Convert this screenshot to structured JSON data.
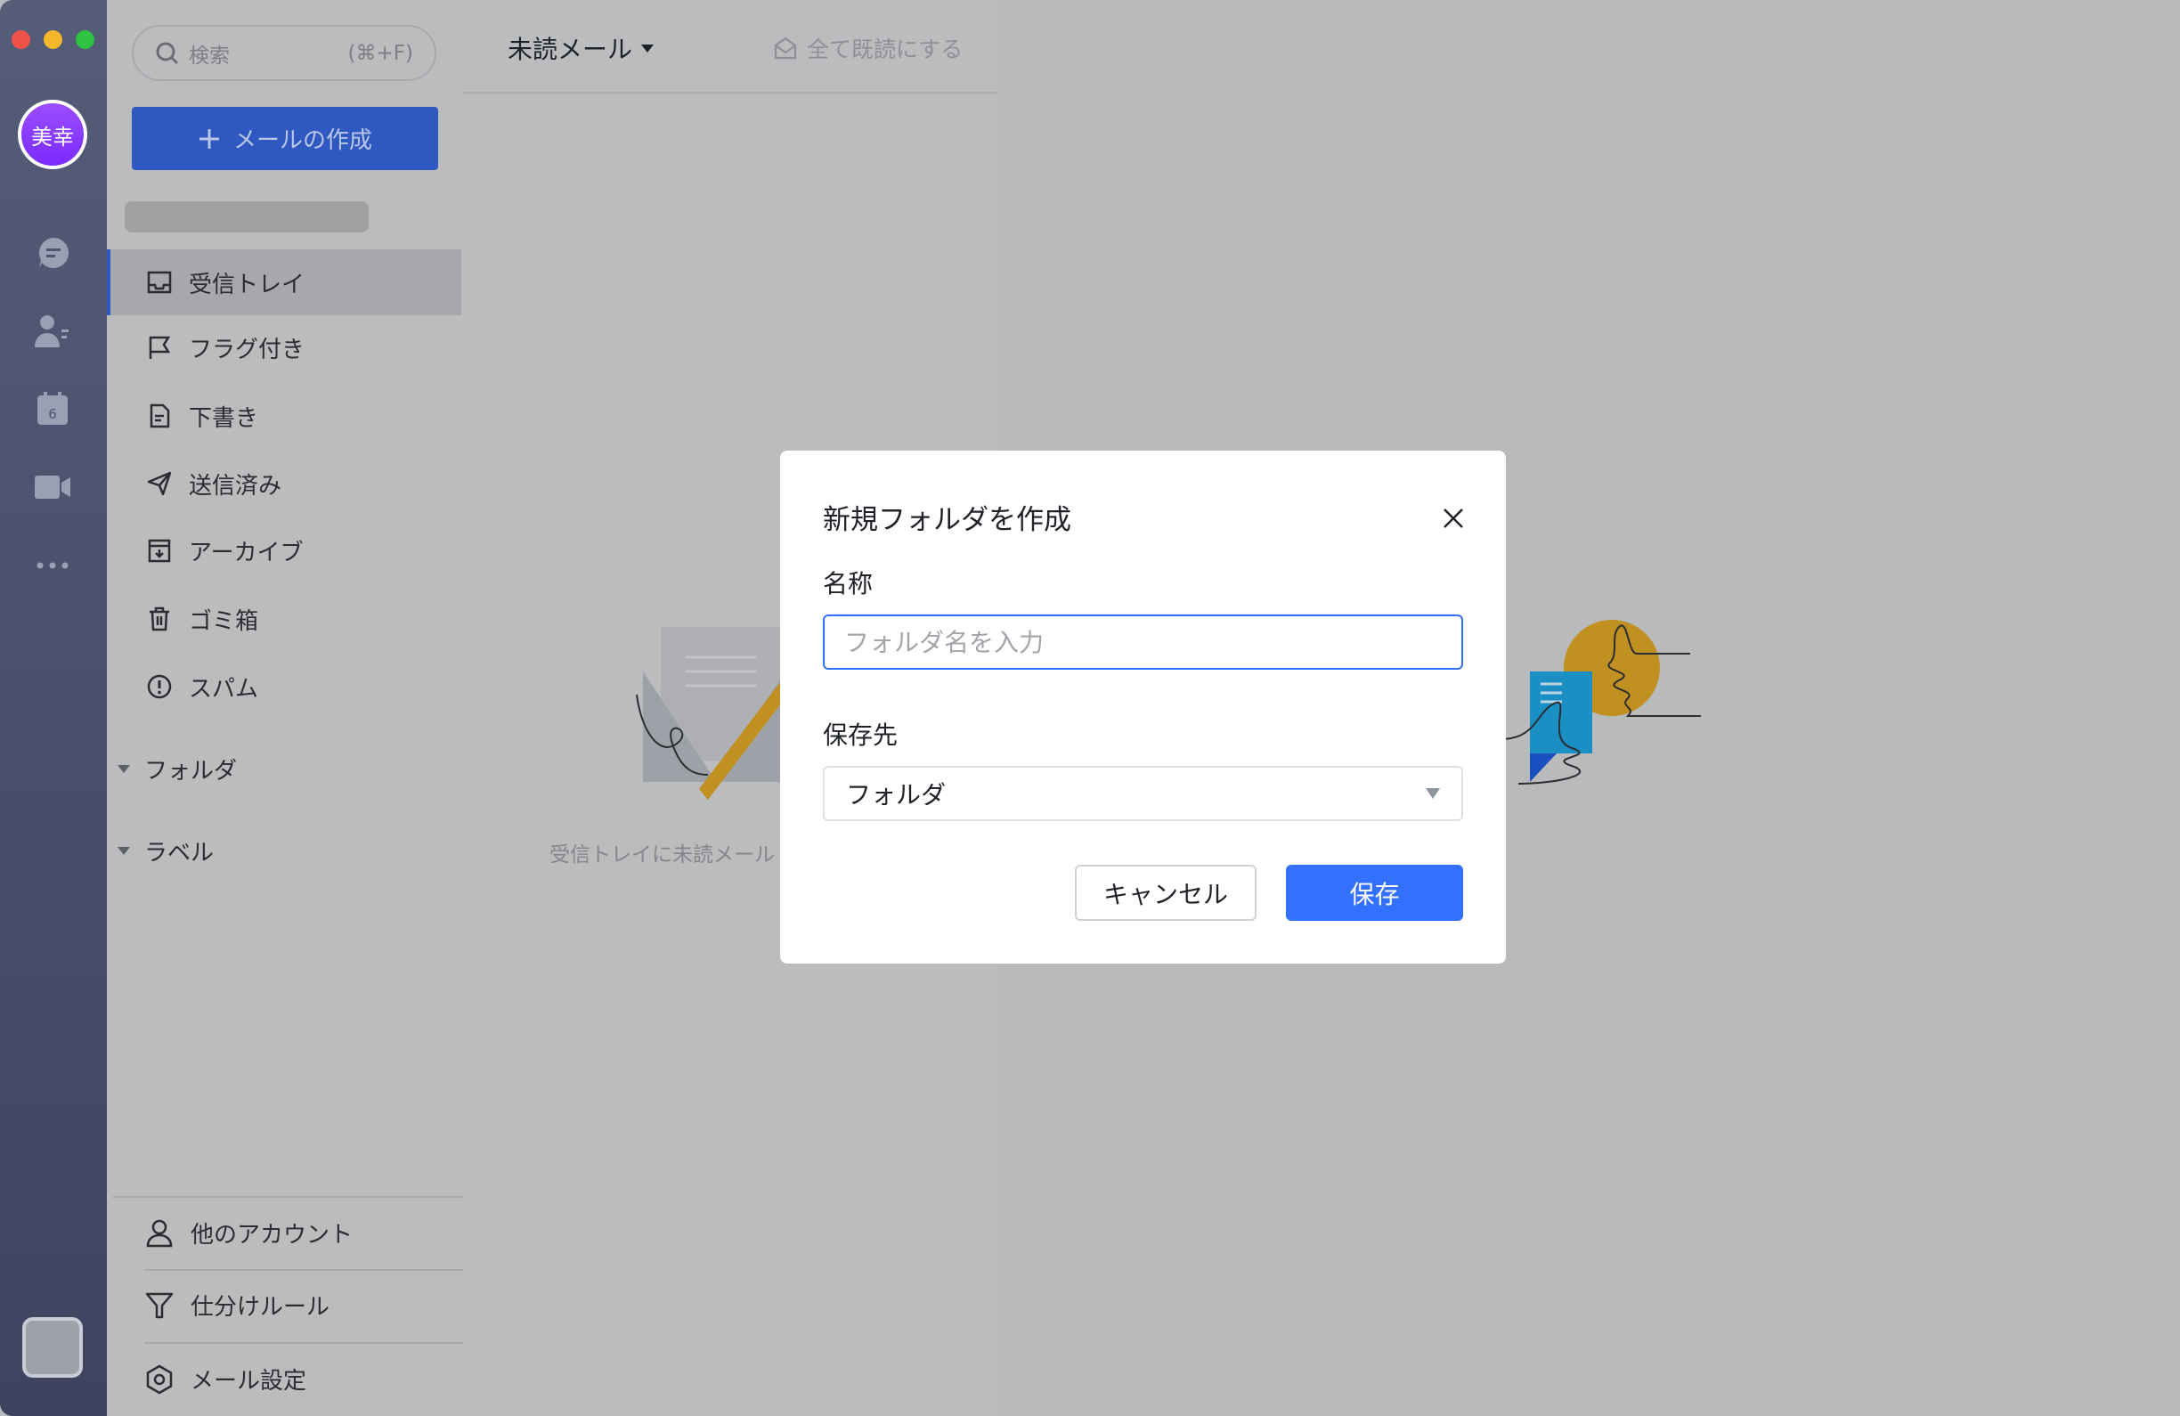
{
  "rail": {
    "avatar_text": "美幸",
    "icons": [
      "chat-icon",
      "contacts-icon",
      "calendar-icon",
      "video-icon",
      "more-icon"
    ],
    "calendar_day": "6"
  },
  "sidebar": {
    "search_placeholder": "検索",
    "search_shortcut": "(⌘+F)",
    "compose_label": "メールの作成",
    "items": [
      {
        "label": "受信トレイ",
        "icon": "inbox-icon",
        "selected": true
      },
      {
        "label": "フラグ付き",
        "icon": "flag-icon"
      },
      {
        "label": "下書き",
        "icon": "draft-icon"
      },
      {
        "label": "送信済み",
        "icon": "send-icon"
      },
      {
        "label": "アーカイブ",
        "icon": "archive-icon"
      },
      {
        "label": "ゴミ箱",
        "icon": "trash-icon"
      },
      {
        "label": "スパム",
        "icon": "spam-icon"
      }
    ],
    "sections": {
      "folders": "フォルダ",
      "labels": "ラベル"
    },
    "bottom": [
      {
        "label": "他のアカウント",
        "icon": "user-icon"
      },
      {
        "label": "仕分けルール",
        "icon": "filter-icon"
      },
      {
        "label": "メール設定",
        "icon": "settings-icon"
      }
    ]
  },
  "list": {
    "filter_label": "未読メール",
    "mark_all_read": "全て既読にする",
    "empty_text": "受信トレイに未読メール"
  },
  "modal": {
    "title": "新規フォルダを作成",
    "name_label": "名称",
    "name_placeholder": "フォルダ名を入力",
    "name_value": "",
    "dest_label": "保存先",
    "dest_value": "フォルダ",
    "cancel_label": "キャンセル",
    "save_label": "保存"
  },
  "colors": {
    "accent": "#3370ff",
    "compose": "#2f58c0",
    "avatar": "#8a3cff"
  }
}
